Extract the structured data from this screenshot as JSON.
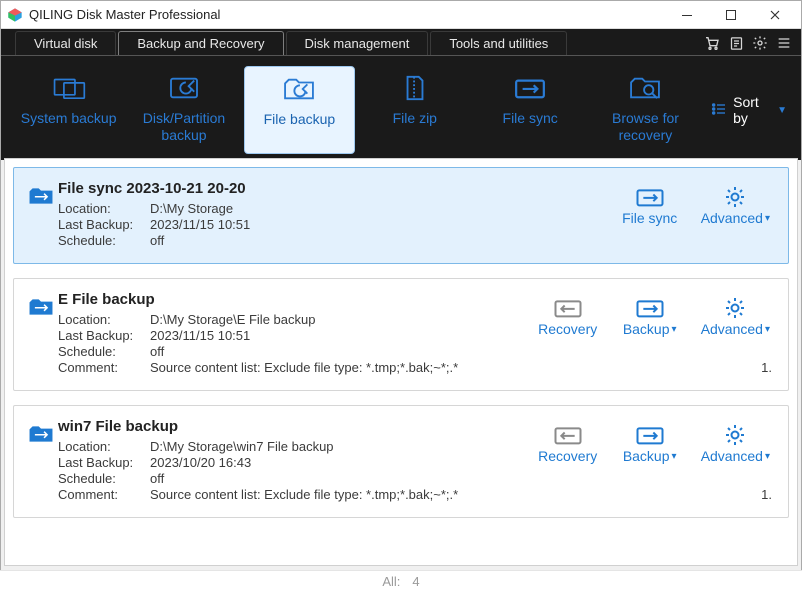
{
  "window": {
    "title": "QILING Disk Master Professional"
  },
  "tabs": [
    {
      "label": "Virtual disk",
      "active": false
    },
    {
      "label": "Backup and Recovery",
      "active": true
    },
    {
      "label": "Disk management",
      "active": false
    },
    {
      "label": "Tools and utilities",
      "active": false
    }
  ],
  "toolbar": [
    {
      "id": "system-backup",
      "label": "System backup",
      "active": false
    },
    {
      "id": "disk-partition-backup",
      "label": "Disk/Partition backup",
      "active": false
    },
    {
      "id": "file-backup",
      "label": "File backup",
      "active": true
    },
    {
      "id": "file-zip",
      "label": "File zip",
      "active": false
    },
    {
      "id": "file-sync",
      "label": "File sync",
      "active": false
    },
    {
      "id": "browse-recovery",
      "label": "Browse for recovery",
      "active": false
    }
  ],
  "sort": {
    "label": "Sort by"
  },
  "labels": {
    "location": "Location:",
    "last_backup": "Last Backup:",
    "schedule": "Schedule:",
    "comment": "Comment:"
  },
  "jobs": [
    {
      "selected": true,
      "title": "File sync 2023-10-21 20-20",
      "rows": {
        "location": "D:\\My Storage",
        "last_backup": "2023/11/15 10:51",
        "schedule": "off"
      },
      "actions": [
        {
          "id": "file-sync",
          "label": "File sync",
          "type": "sync",
          "caret": false
        },
        {
          "id": "advanced",
          "label": "Advanced",
          "type": "gear",
          "caret": true
        }
      ]
    },
    {
      "selected": false,
      "title": "E  File backup",
      "rows": {
        "location": "D:\\My Storage\\E  File backup",
        "last_backup": "2023/11/15 10:51",
        "schedule": "off",
        "comment": "Source content list:  Exclude file type: *.tmp;*.bak;~*;.*",
        "comment_extra": "1."
      },
      "actions": [
        {
          "id": "recovery",
          "label": "Recovery",
          "type": "recovery",
          "caret": false
        },
        {
          "id": "backup",
          "label": "Backup",
          "type": "sync",
          "caret": true
        },
        {
          "id": "advanced",
          "label": "Advanced",
          "type": "gear",
          "caret": true
        }
      ]
    },
    {
      "selected": false,
      "title": "win7 File backup",
      "rows": {
        "location": "D:\\My Storage\\win7 File backup",
        "last_backup": "2023/10/20 16:43",
        "schedule": "off",
        "comment": "Source content list:  Exclude file type: *.tmp;*.bak;~*;.*",
        "comment_extra": "1."
      },
      "actions": [
        {
          "id": "recovery",
          "label": "Recovery",
          "type": "recovery",
          "caret": false
        },
        {
          "id": "backup",
          "label": "Backup",
          "type": "sync",
          "caret": true
        },
        {
          "id": "advanced",
          "label": "Advanced",
          "type": "gear",
          "caret": true
        }
      ]
    }
  ],
  "status": {
    "all_label": "All:",
    "count": "4"
  },
  "colors": {
    "accent": "#1f7ad1",
    "dark": "#1a1a1a"
  }
}
